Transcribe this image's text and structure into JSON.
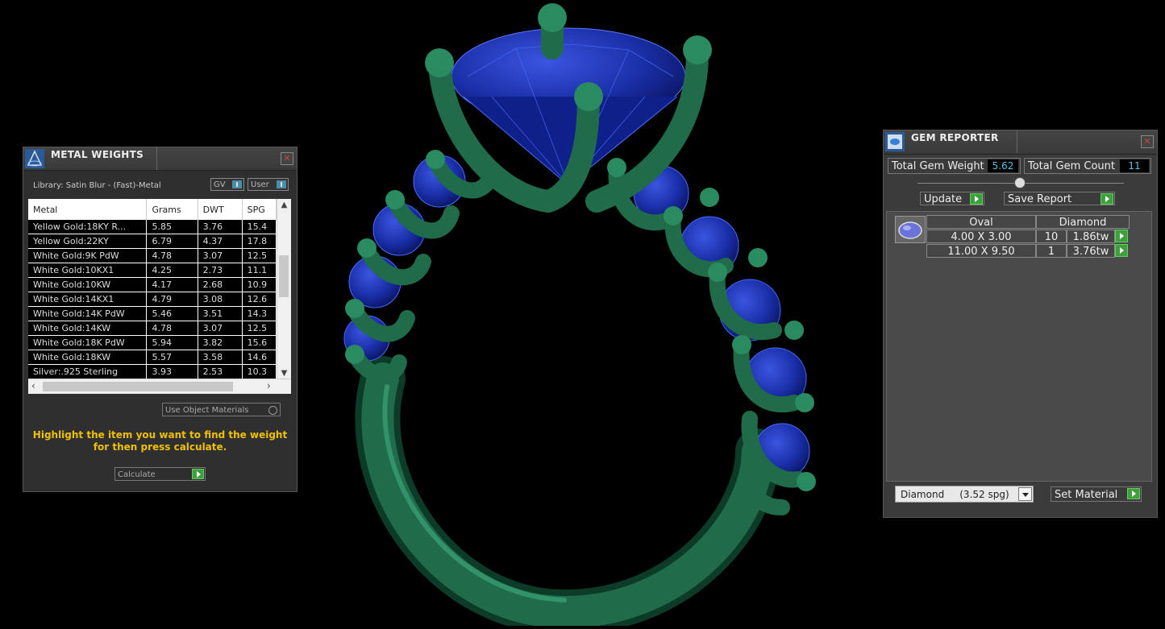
{
  "metal_weights": {
    "title": "METAL WEIGHTS",
    "library_label": "Library: Satin Blur - (Fast)-Metal",
    "toggle_gv": "GV",
    "toggle_user": "User",
    "columns": [
      "Metal",
      "Grams",
      "DWT",
      "SPG"
    ],
    "rows": [
      [
        "Yellow Gold:18KY R...",
        "5.85",
        "3.76",
        "15.4"
      ],
      [
        "Yellow Gold:22KY",
        "6.79",
        "4.37",
        "17.8"
      ],
      [
        "White Gold:9K PdW",
        "4.78",
        "3.07",
        "12.5"
      ],
      [
        "White Gold:10KX1",
        "4.25",
        "2.73",
        "11.1"
      ],
      [
        "White Gold:10KW",
        "4.17",
        "2.68",
        "10.9"
      ],
      [
        "White Gold:14KX1",
        "4.79",
        "3.08",
        "12.6"
      ],
      [
        "White Gold:14K PdW",
        "5.46",
        "3.51",
        "14.3"
      ],
      [
        "White Gold:14KW",
        "4.78",
        "3.07",
        "12.5"
      ],
      [
        "White Gold:18K PdW",
        "5.94",
        "3.82",
        "15.6"
      ],
      [
        "White Gold:18KW",
        "5.57",
        "3.58",
        "14.6"
      ],
      [
        "Silver:.925 Sterling",
        "3.93",
        "2.53",
        "10.3"
      ]
    ],
    "use_object_materials": "Use Object Materials",
    "hint_line1": "Highlight the item you want to find the weight",
    "hint_line2": "for then press calculate.",
    "calculate_label": "Calculate",
    "close_symbol": "✕"
  },
  "gem_reporter": {
    "title": "GEM REPORTER",
    "total_weight_label": "Total Gem Weight",
    "total_weight_value": "5.62",
    "total_count_label": "Total Gem Count",
    "total_count_value": "11",
    "update_label": "Update",
    "save_report_label": "Save Report",
    "shape_header": "Oval",
    "type_header": "Diamond",
    "gem_rows": [
      {
        "size": "4.00 X 3.00",
        "count": "10",
        "weight": "1.86tw"
      },
      {
        "size": "11.00 X 9.50",
        "count": "1",
        "weight": "3.76tw"
      }
    ],
    "material_select": "Diamond     (3.52 spg)",
    "set_material_label": "Set Material",
    "close_symbol": "✕"
  },
  "colors": {
    "metal_green": "#1f6b4a",
    "gem_blue": "#1a2fa8",
    "hint_yellow": "#f0c000",
    "value_cyan": "#4fc3e0",
    "go_green": "#3da03d"
  }
}
